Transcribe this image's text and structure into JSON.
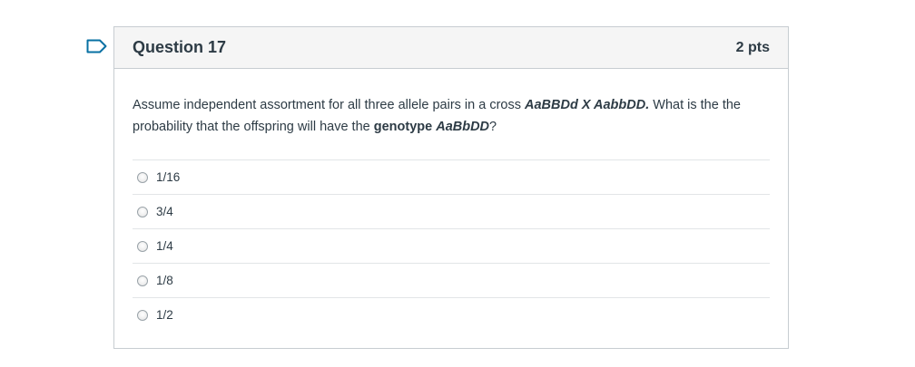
{
  "question": {
    "title": "Question 17",
    "points": "2 pts",
    "text": {
      "part1": "Assume independent assortment for all three allele pairs in a cross ",
      "cross_expr": "AaBBDd X AabbDD.",
      "part2": " What is the the probability that the offspring will have the ",
      "genotype_word": "genotype ",
      "genotype_value": "AaBbDD",
      "part3": "?"
    },
    "answers": [
      {
        "label": "1/16"
      },
      {
        "label": "3/4"
      },
      {
        "label": "1/4"
      },
      {
        "label": "1/8"
      },
      {
        "label": "1/2"
      }
    ]
  },
  "icons": {
    "flag": "bookmark-flag-icon",
    "radio": "radio-button-icon"
  },
  "colors": {
    "flag": "#0770a3",
    "text": "#2d3b45",
    "header_bg": "#f5f5f5",
    "border": "#c7cdd1",
    "divider": "#e2e5e7"
  }
}
